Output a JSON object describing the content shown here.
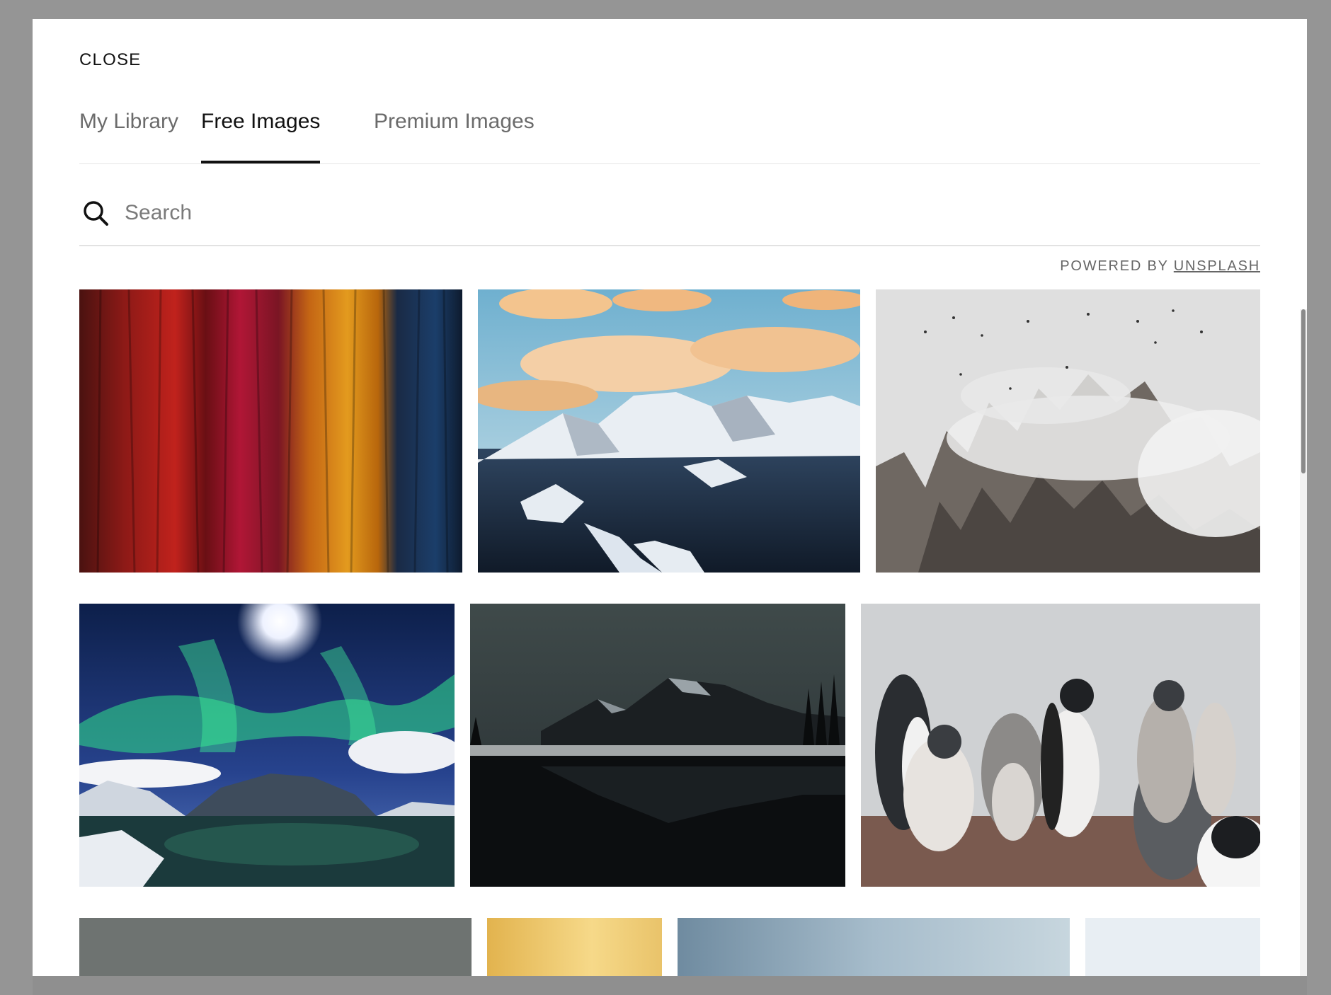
{
  "modal": {
    "close_label": "CLOSE",
    "tabs": [
      {
        "label": "My Library",
        "active": false
      },
      {
        "label": "Free Images",
        "active": true
      },
      {
        "label": "Premium Images",
        "active": false
      }
    ],
    "search": {
      "placeholder": "Search",
      "value": ""
    },
    "powered_by": {
      "prefix": "POWERED BY",
      "link": "UNSPLASH"
    }
  },
  "images": [
    {
      "subject": "colorful fabric",
      "row": 1
    },
    {
      "subject": "snowy mountains over sea at sunset",
      "row": 1
    },
    {
      "subject": "misty mountain peaks with birds",
      "row": 1
    },
    {
      "subject": "aurora over lake and hills",
      "row": 2
    },
    {
      "subject": "mountains reflected in dark lake",
      "row": 2
    },
    {
      "subject": "penguins",
      "row": 2
    },
    {
      "subject": "grey overcast sky",
      "row": 3
    },
    {
      "subject": "golden sunrise sky",
      "row": 3
    },
    {
      "subject": "misty blue landscape",
      "row": 3
    },
    {
      "subject": "pale sky",
      "row": 3
    }
  ],
  "colors": {
    "backdrop": "#959595",
    "active_tab": "#111111",
    "inactive_tab": "#6b6b6b"
  },
  "icons": [
    "search-icon"
  ]
}
